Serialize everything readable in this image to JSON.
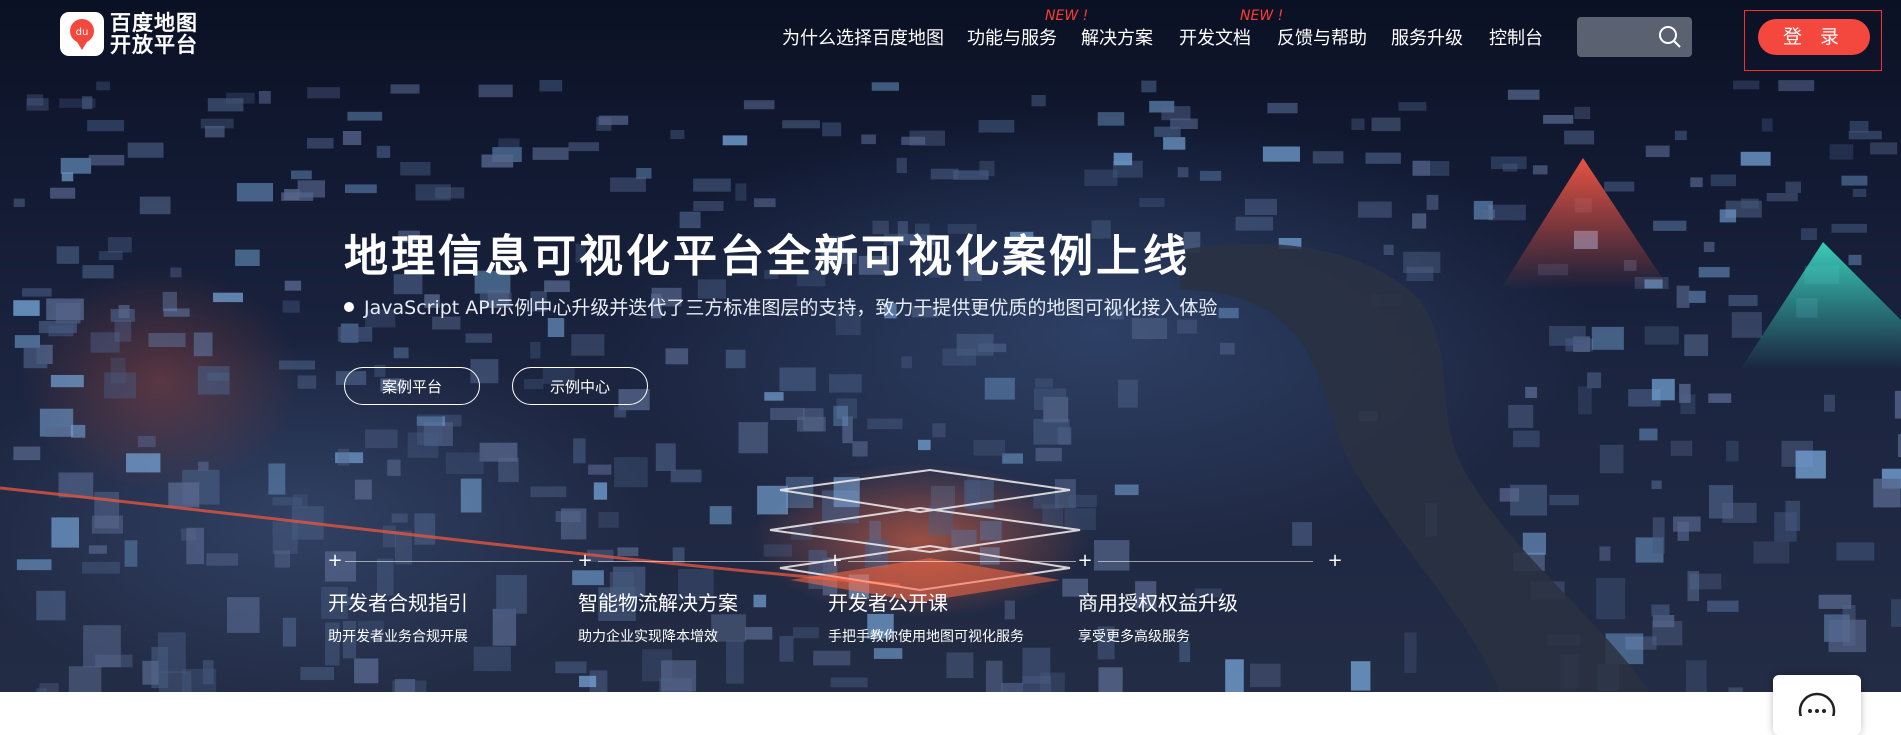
{
  "brand": {
    "logo_text_line1": "百度地图",
    "logo_text_line2": "开放平台",
    "logo_badge": "du",
    "accent": "#f4483e"
  },
  "nav": {
    "items": [
      {
        "label": "为什么选择百度地图"
      },
      {
        "label": "功能与服务",
        "badge": "NEW !"
      },
      {
        "label": "解决方案"
      },
      {
        "label": "开发文档",
        "badge": "NEW !"
      },
      {
        "label": "反馈与帮助"
      },
      {
        "label": "服务升级"
      },
      {
        "label": "控制台"
      }
    ],
    "login_label": "登 录"
  },
  "hero": {
    "title": "地理信息可视化平台全新可视化案例上线",
    "subtitle": "JavaScript API示例中心升级并迭代了三方标准图层的支持，致力于提供更优质的地图可视化接入体验",
    "buttons": [
      "案例平台",
      "示例中心"
    ]
  },
  "features": [
    {
      "title": "开发者合规指引",
      "desc": "助开发者业务合规开展"
    },
    {
      "title": "智能物流解决方案",
      "desc": "助力企业实现降本增效"
    },
    {
      "title": "开发者公开课",
      "desc": "手把手教你使用地图可视化服务"
    },
    {
      "title": "商用授权权益升级",
      "desc": "享受更多高级服务"
    }
  ]
}
